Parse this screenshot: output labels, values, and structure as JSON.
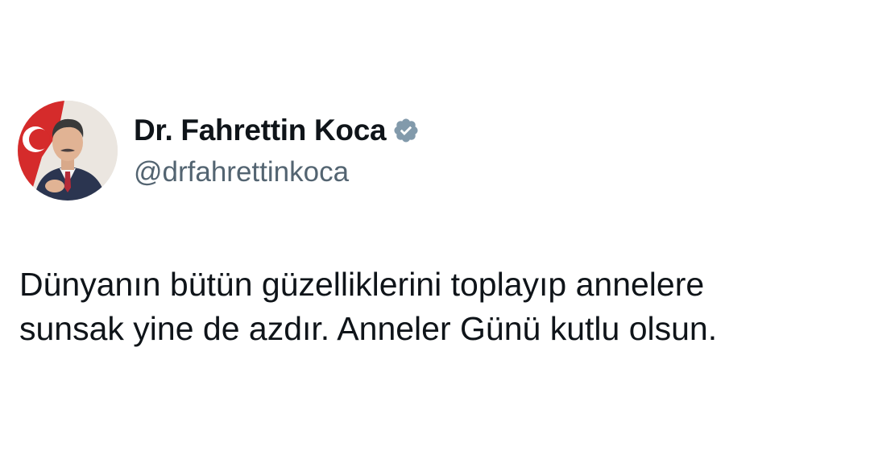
{
  "author": {
    "display_name": "Dr. Fahrettin Koca",
    "handle": "@drfahrettinkoca",
    "verified_icon": "verified-badge-icon",
    "avatar": "profile-photo"
  },
  "tweet": {
    "lines": [
      "Dünyanın bütün güzelliklerini toplayıp annelere",
      "sunsak yine de azdır. Anneler Günü kutlu olsun."
    ]
  },
  "colors": {
    "text": "#0f1419",
    "secondary": "#536471",
    "verified": "#829aab",
    "background": "#ffffff"
  }
}
